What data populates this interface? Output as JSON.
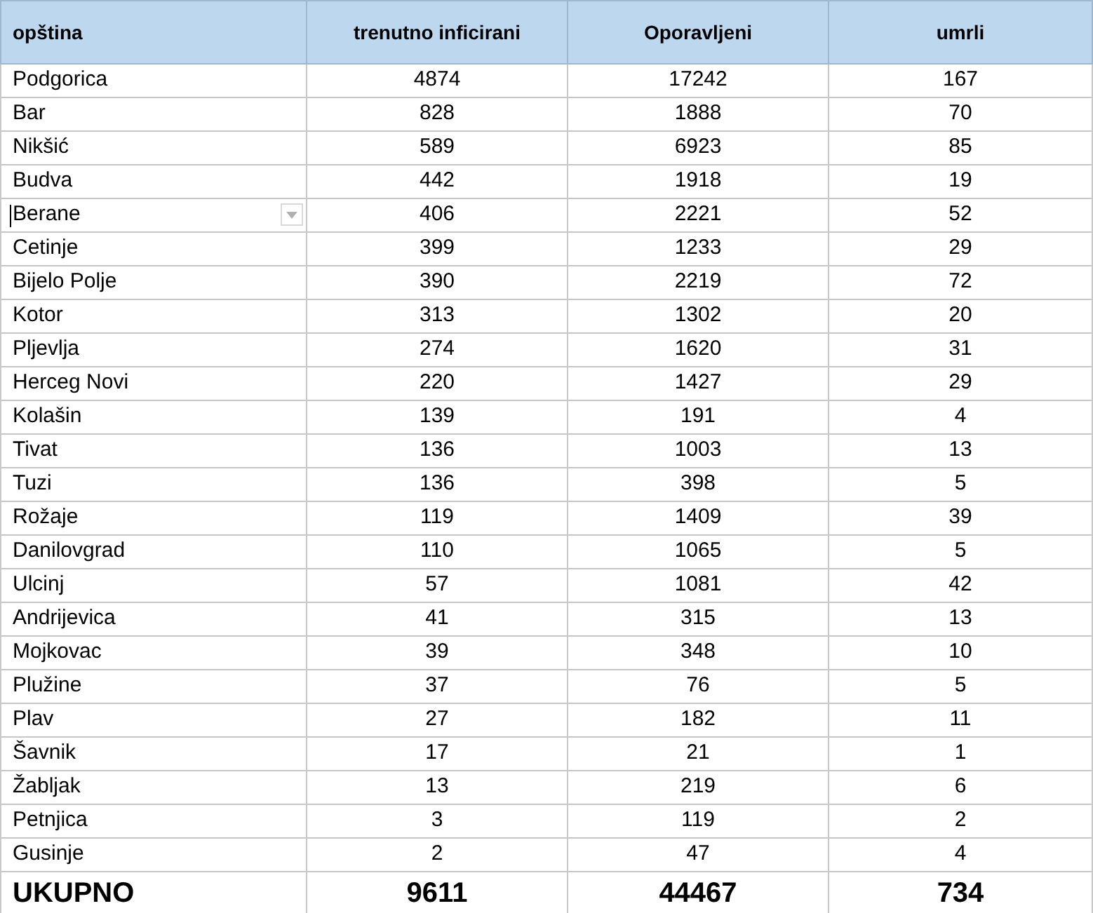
{
  "table": {
    "columns": [
      "opština",
      "trenutno inficirani",
      "Oporavljeni",
      "umrli"
    ],
    "rows": [
      {
        "cells": [
          "Podgorica",
          "4874",
          "17242",
          "167"
        ],
        "active": false
      },
      {
        "cells": [
          "Bar",
          "828",
          "1888",
          "70"
        ],
        "active": false
      },
      {
        "cells": [
          "Nikšić",
          "589",
          "6923",
          "85"
        ],
        "active": false
      },
      {
        "cells": [
          "Budva",
          "442",
          "1918",
          "19"
        ],
        "active": false
      },
      {
        "cells": [
          "Berane",
          "406",
          "2221",
          "52"
        ],
        "active": true
      },
      {
        "cells": [
          "Cetinje",
          "399",
          "1233",
          "29"
        ],
        "active": false
      },
      {
        "cells": [
          "Bijelo Polje",
          "390",
          "2219",
          "72"
        ],
        "active": false
      },
      {
        "cells": [
          "Kotor",
          "313",
          "1302",
          "20"
        ],
        "active": false
      },
      {
        "cells": [
          "Pljevlja",
          "274",
          "1620",
          "31"
        ],
        "active": false
      },
      {
        "cells": [
          "Herceg Novi",
          "220",
          "1427",
          "29"
        ],
        "active": false
      },
      {
        "cells": [
          "Kolašin",
          "139",
          "191",
          "4"
        ],
        "active": false
      },
      {
        "cells": [
          "Tivat",
          "136",
          "1003",
          "13"
        ],
        "active": false
      },
      {
        "cells": [
          "Tuzi",
          "136",
          "398",
          "5"
        ],
        "active": false
      },
      {
        "cells": [
          "Rožaje",
          "119",
          "1409",
          "39"
        ],
        "active": false
      },
      {
        "cells": [
          "Danilovgrad",
          "110",
          "1065",
          "5"
        ],
        "active": false
      },
      {
        "cells": [
          "Ulcinj",
          "57",
          "1081",
          "42"
        ],
        "active": false
      },
      {
        "cells": [
          "Andrijevica",
          "41",
          "315",
          "13"
        ],
        "active": false
      },
      {
        "cells": [
          "Mojkovac",
          "39",
          "348",
          "10"
        ],
        "active": false
      },
      {
        "cells": [
          "Plužine",
          "37",
          "76",
          "5"
        ],
        "active": false
      },
      {
        "cells": [
          "Plav",
          "27",
          "182",
          "11"
        ],
        "active": false
      },
      {
        "cells": [
          "Šavnik",
          "17",
          "21",
          "1"
        ],
        "active": false
      },
      {
        "cells": [
          "Žabljak",
          "13",
          "219",
          "6"
        ],
        "active": false
      },
      {
        "cells": [
          "Petnjica",
          "3",
          "119",
          "2"
        ],
        "active": false
      },
      {
        "cells": [
          "Gusinje",
          "2",
          "47",
          "4"
        ],
        "active": false
      }
    ],
    "total": [
      "UKUPNO",
      "9611",
      "44467",
      "734"
    ]
  }
}
